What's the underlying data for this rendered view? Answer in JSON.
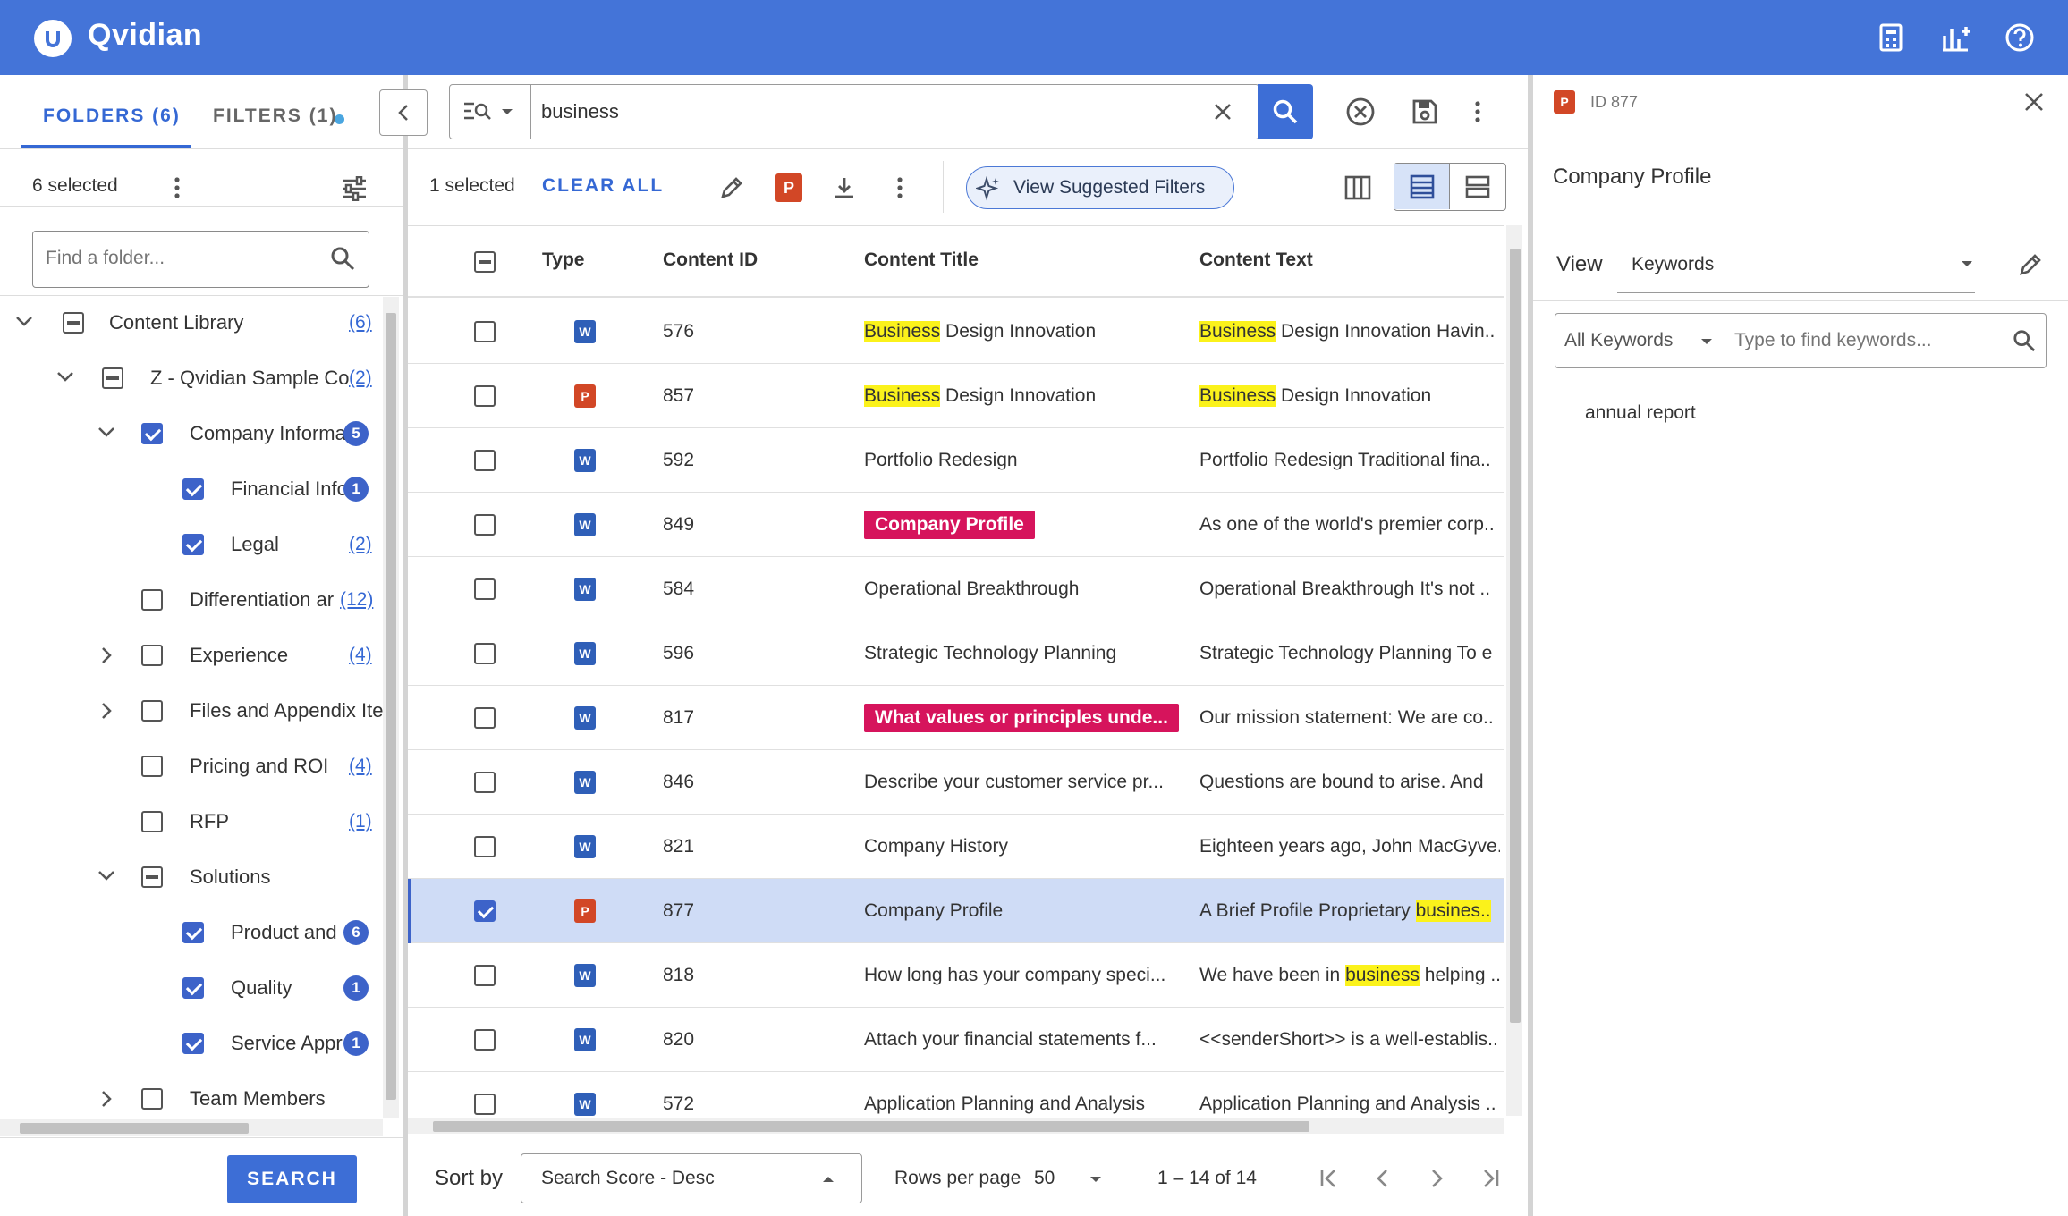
{
  "app": {
    "title": "Qvidian"
  },
  "left": {
    "tabs": [
      {
        "label": "FOLDERS (6)"
      },
      {
        "label": "FILTERS (1)"
      }
    ],
    "selected_count": "6 selected",
    "folder_search_placeholder": "Find a folder...",
    "tree": [
      {
        "label": "Content Library",
        "count": "(6)"
      },
      {
        "label": "Z - Qvidian Sample Con",
        "count": "(2)"
      },
      {
        "label": "Company Informa",
        "count": "5"
      },
      {
        "label": "Financial Info",
        "count": "1"
      },
      {
        "label": "Legal",
        "count": "(2)"
      },
      {
        "label": "Differentiation ar",
        "count": "(12)"
      },
      {
        "label": "Experience",
        "count": "(4)"
      },
      {
        "label": "Files and Appendix Ite",
        "count": ""
      },
      {
        "label": "Pricing and ROI",
        "count": "(4)"
      },
      {
        "label": "RFP",
        "count": "(1)"
      },
      {
        "label": "Solutions",
        "count": ""
      },
      {
        "label": "Product and",
        "count": "6"
      },
      {
        "label": "Quality",
        "count": "1"
      },
      {
        "label": "Service Appr",
        "count": "1"
      },
      {
        "label": "Team Members",
        "count": ""
      }
    ],
    "search_button": "SEARCH"
  },
  "center": {
    "search_value": "business",
    "selected_text": "1 selected",
    "clear_all": "CLEAR ALL",
    "suggest_label": "View Suggested Filters",
    "columns": {
      "type": "Type",
      "id": "Content ID",
      "title": "Content Title",
      "text": "Content Text"
    },
    "rows": [
      {
        "id": "576",
        "title_hl": "Business",
        "title": " Design Innovation",
        "text_hl": "Business",
        "text": " Design Innovation Havin..",
        "type": "word"
      },
      {
        "id": "857",
        "title_hl": "Business",
        "title": " Design Innovation",
        "text_hl": "Business",
        "text": " Design Innovation",
        "type": "ppt"
      },
      {
        "id": "592",
        "title": "Portfolio Redesign",
        "text": "Portfolio Redesign Traditional fina..",
        "type": "word"
      },
      {
        "id": "849",
        "tag": "Company Profile",
        "text": "As one of the world's premier corp..",
        "type": "word"
      },
      {
        "id": "584",
        "title": "Operational Breakthrough",
        "text": "Operational Breakthrough It's not ..",
        "type": "word"
      },
      {
        "id": "596",
        "title": "Strategic Technology Planning",
        "text": "Strategic Technology Planning To e",
        "type": "word"
      },
      {
        "id": "817",
        "tag": "What values or principles unde...",
        "text": "Our mission statement: We are co..",
        "type": "word"
      },
      {
        "id": "846",
        "title": "Describe your customer service pr...",
        "text": "Questions are bound to arise. And",
        "type": "word"
      },
      {
        "id": "821",
        "title": "Company History",
        "text": "Eighteen years ago, John MacGyve..",
        "type": "word"
      },
      {
        "id": "877",
        "title": "Company Profile",
        "text": "A Brief Profile Proprietary ",
        "text_hl_end": "busines..",
        "type": "ppt",
        "selected": true
      },
      {
        "id": "818",
        "title": "How long has your company speci...",
        "text": "We have been in ",
        "text_hl_mid": "business",
        "text_after": " helping ..",
        "type": "word"
      },
      {
        "id": "820",
        "title": "Attach your financial statements f...",
        "text": "<<senderShort>> is a well-establis..",
        "type": "word"
      },
      {
        "id": "572",
        "title": "Application Planning and Analysis",
        "text": "Application Planning and Analysis ..",
        "type": "word"
      }
    ],
    "sort_label": "Sort by",
    "sort_value": "Search Score - Desc",
    "rows_per_page_label": "Rows per page",
    "rows_per_page_value": "50",
    "pagination": "1 – 14 of 14"
  },
  "right": {
    "doc_id": "ID 877",
    "title": "Company Profile",
    "view_label": "View",
    "view_value": "Keywords",
    "kw_filter": "All Keywords",
    "kw_placeholder": "Type to find keywords...",
    "keywords": [
      "annual report"
    ]
  },
  "colors": {
    "brand": "#4474d8",
    "accent": "#3d63c9",
    "highlight": "#fbf21b",
    "tag": "#d6145c"
  }
}
